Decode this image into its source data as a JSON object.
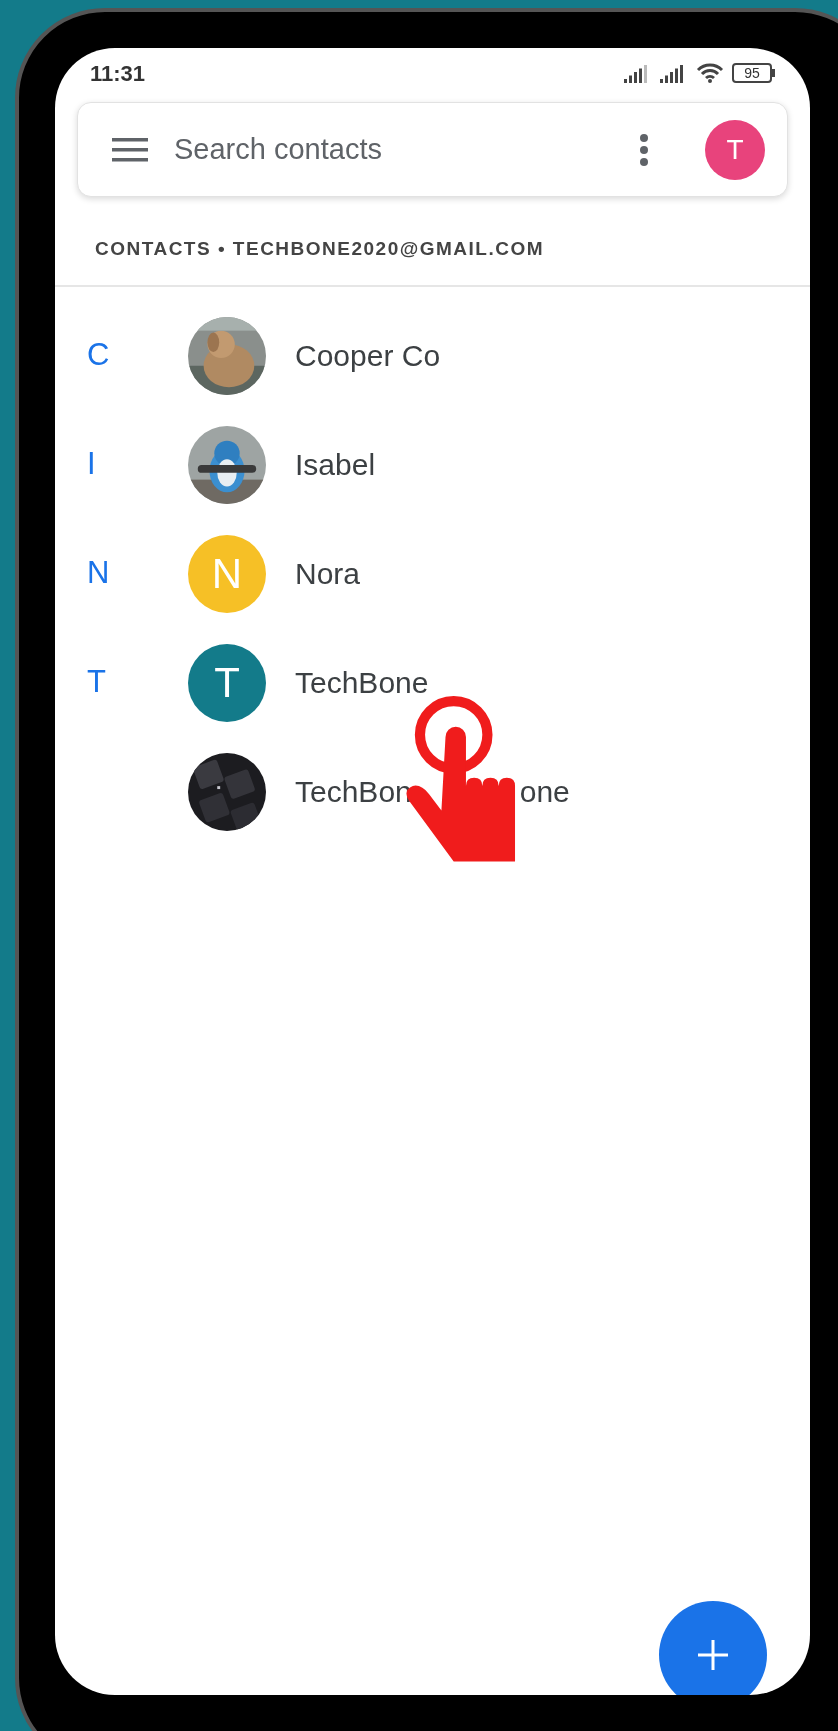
{
  "status_bar": {
    "time": "11:31",
    "battery": "95"
  },
  "search_bar": {
    "placeholder": "Search contacts",
    "account_initial": "T"
  },
  "section_header": "CONTACTS • TECHBONE2020@GMAIL.COM",
  "contacts": [
    {
      "letter": "C",
      "name": "Cooper Co"
    },
    {
      "letter": "I",
      "name": "Isabel"
    },
    {
      "letter": "N",
      "name": "Nora",
      "avatar": {
        "kind": "letter",
        "text": "N",
        "color": "#f6c026"
      }
    },
    {
      "letter": "T",
      "name": "TechBone",
      "avatar": {
        "kind": "letter",
        "text": "T",
        "color": "#137b8a"
      }
    },
    {
      "name": "TechBon",
      "name_tail": "one"
    }
  ]
}
